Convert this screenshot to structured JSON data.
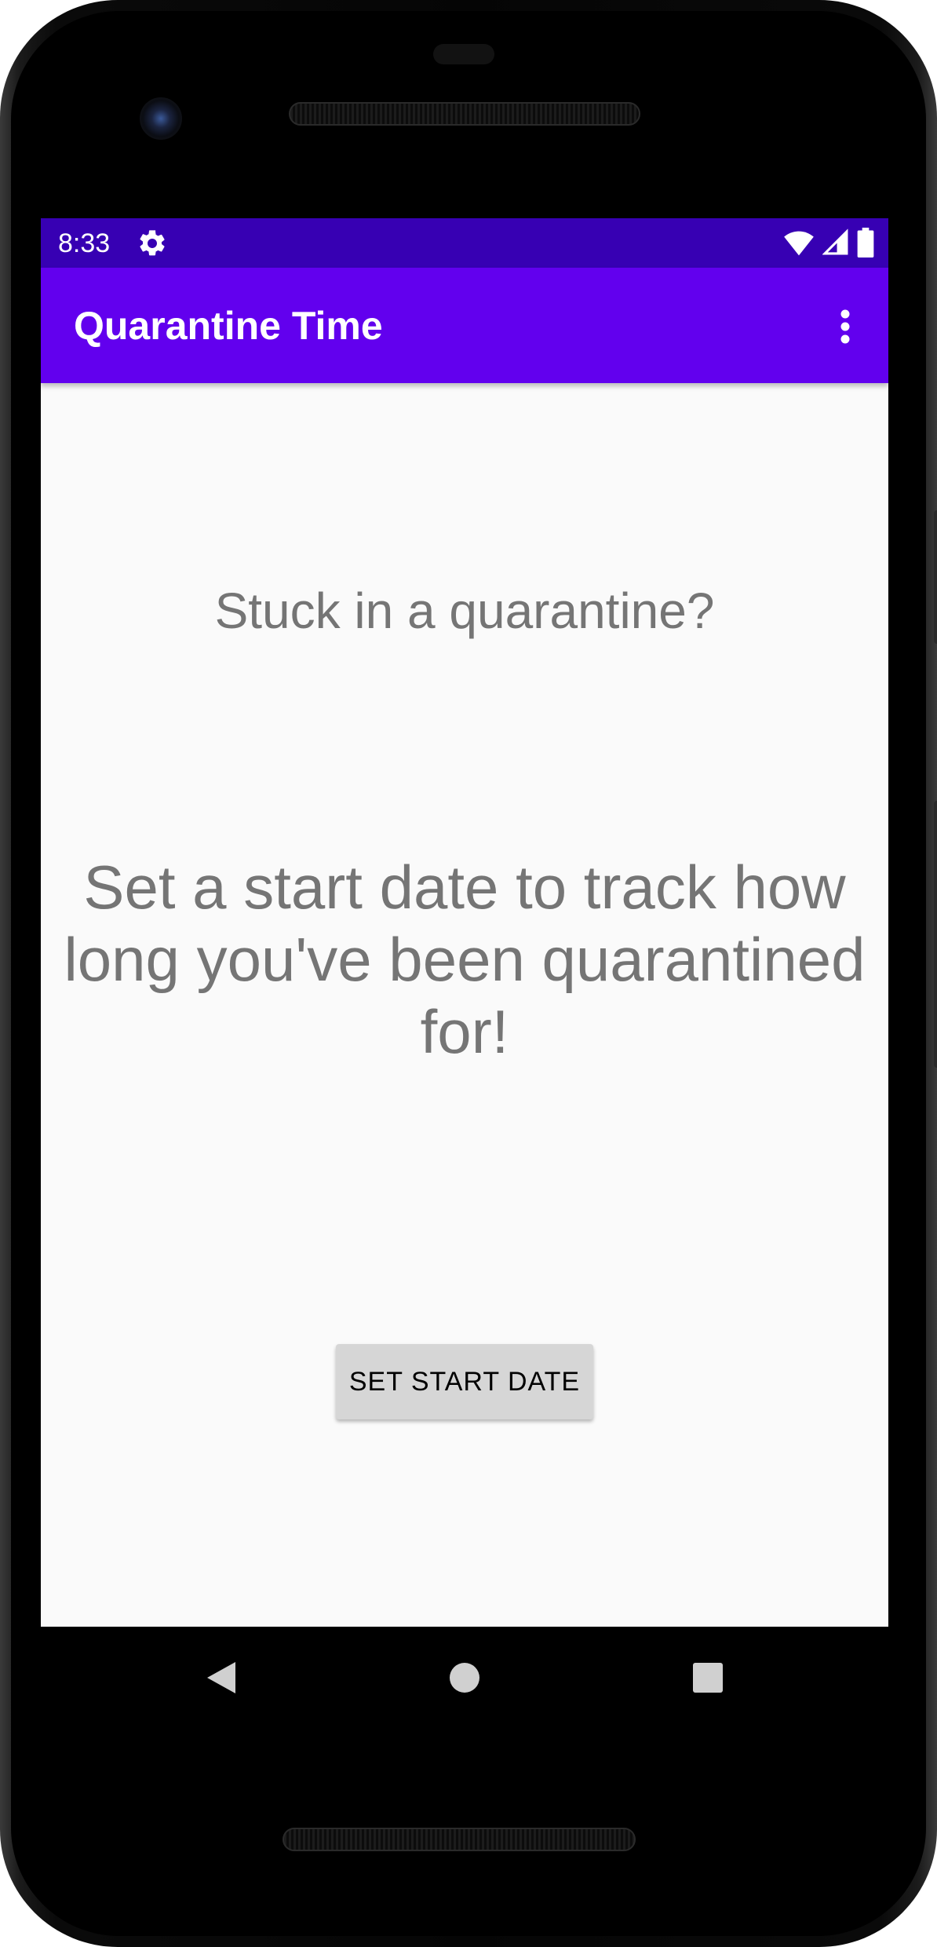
{
  "status_bar": {
    "time": "8:33",
    "icons": [
      "settings-icon",
      "wifi-icon",
      "cell-signal-icon",
      "battery-icon"
    ],
    "background": "#3700b3"
  },
  "app_bar": {
    "title": "Quarantine Time",
    "overflow_icon": "more-vert-icon",
    "background": "#6200ee"
  },
  "content": {
    "subtitle": "Stuck in a quarantine?",
    "message": "Set a start date to track how long you've been quarantined for!",
    "button_label": "SET START DATE",
    "text_color": "#757575",
    "background": "#fafafa"
  },
  "navigation_bar": {
    "buttons": [
      "back-icon",
      "home-icon",
      "recents-icon"
    ]
  }
}
